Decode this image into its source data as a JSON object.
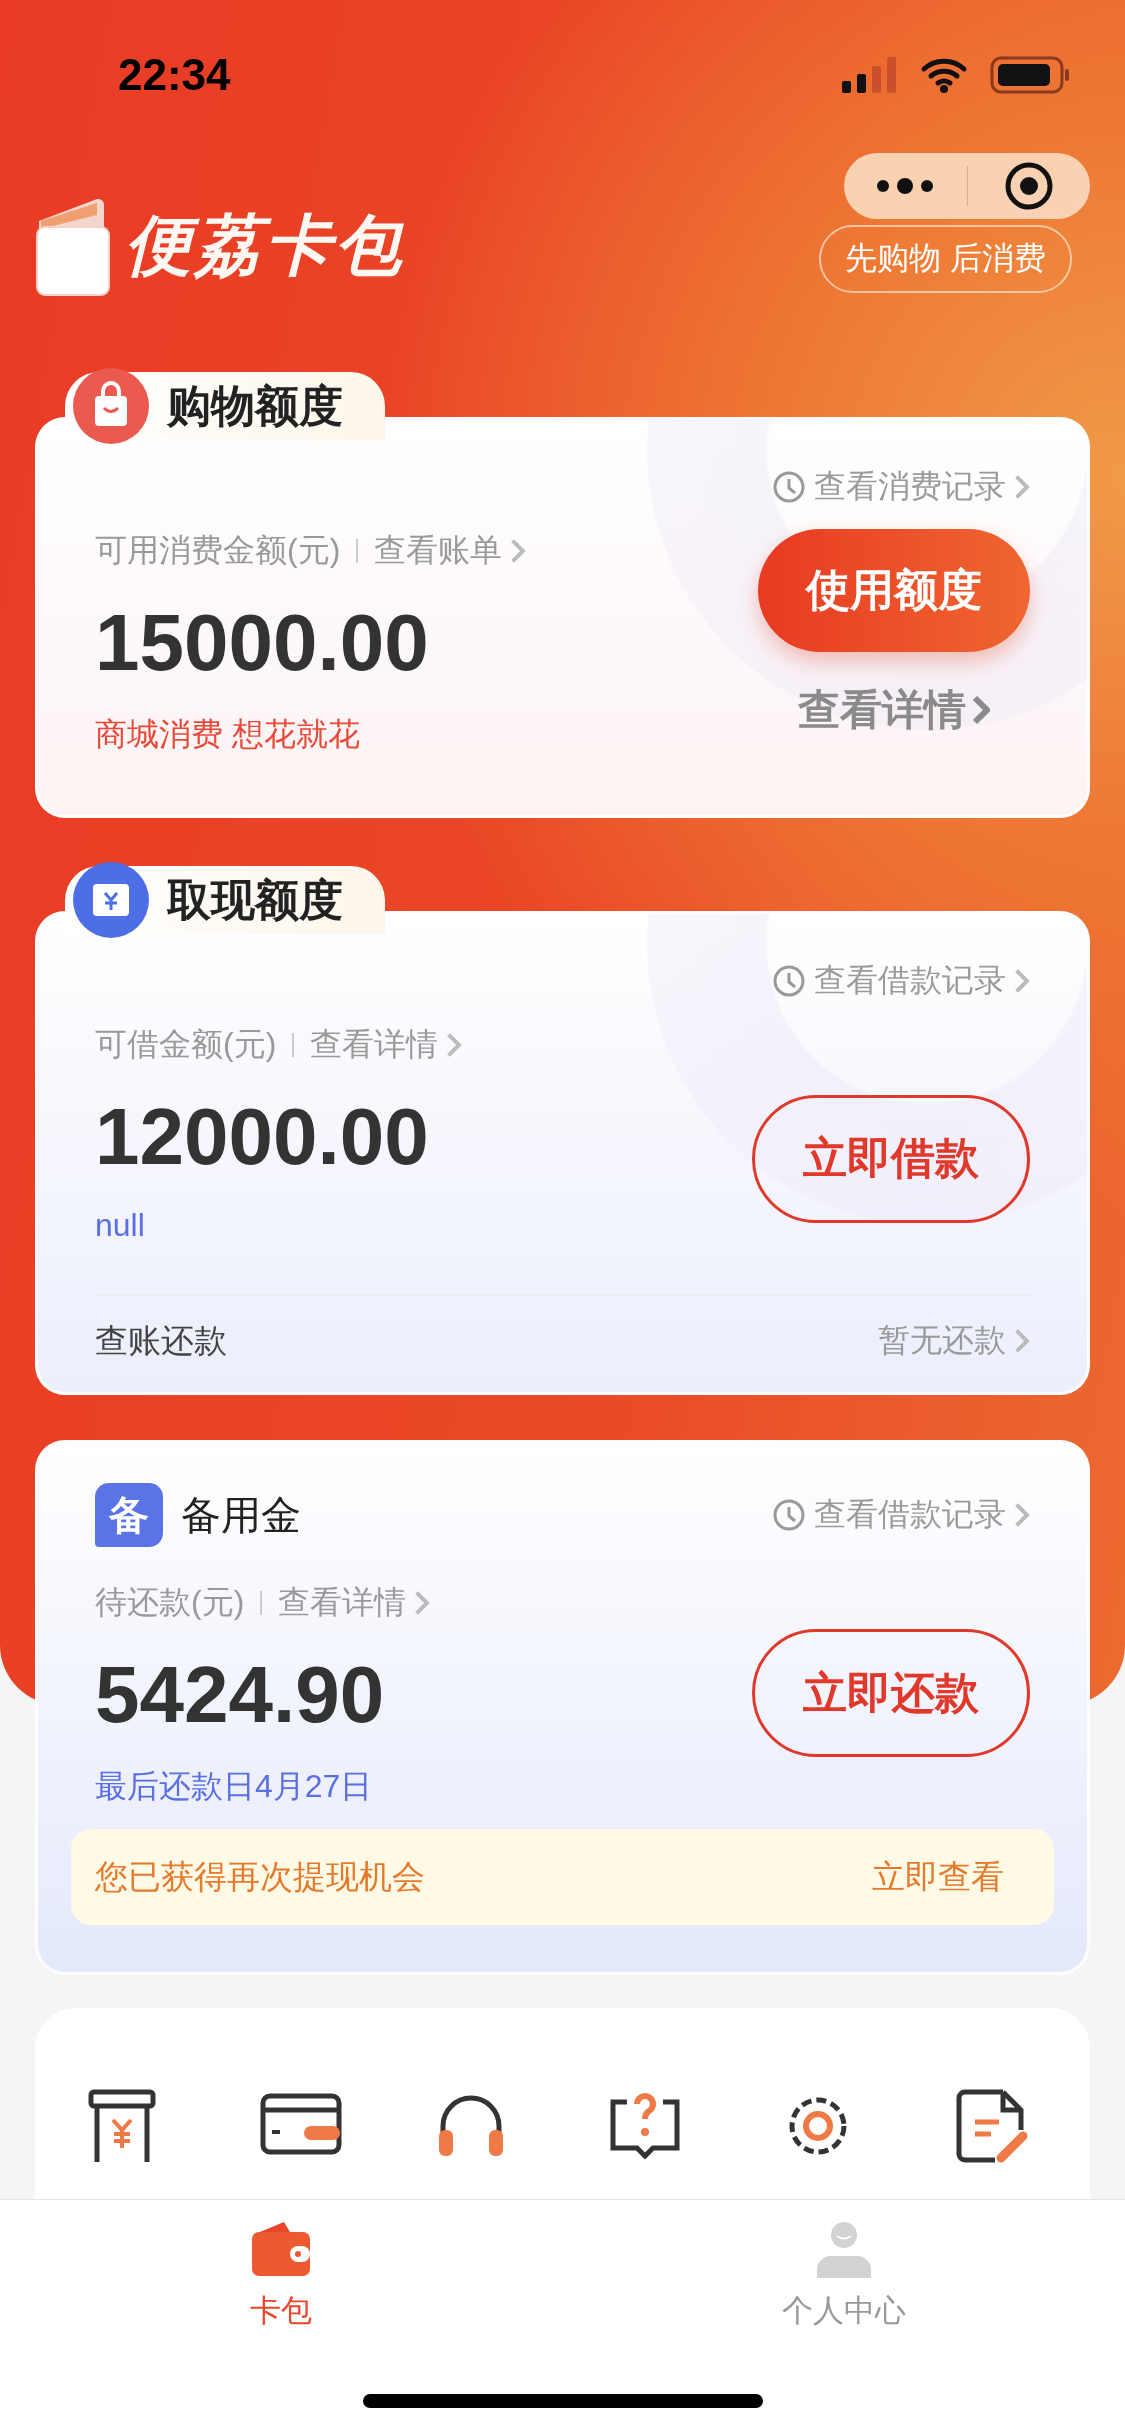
{
  "status_bar": {
    "time": "22:34"
  },
  "header": {
    "app_name": "便荔卡包",
    "slogan": "先购物 后消费"
  },
  "shopping_card": {
    "tab_label": "购物额度",
    "history_link": "查看消费记录",
    "amount_label": "可用消费金额(元)",
    "bill_link": "查看账单",
    "amount": "15000.00",
    "promo": "商城消费 想花就花",
    "button": "使用额度",
    "details_link": "查看详情"
  },
  "cash_card": {
    "tab_label": "取现额度",
    "history_link": "查看借款记录",
    "amount_label": "可借金额(元)",
    "details_link": "查看详情",
    "amount": "12000.00",
    "note": "null",
    "button": "立即借款",
    "footer_label": "查账还款",
    "footer_status": "暂无还款"
  },
  "reserve_card": {
    "badge": "备",
    "title": "备用金",
    "history_link": "查看借款记录",
    "amount_label": "待还款(元)",
    "details_link": "查看详情",
    "amount": "5424.90",
    "due_date": "最后还款日4月27日",
    "button": "立即还款",
    "notice": {
      "text": "您已获得再次提现机会",
      "action": "立即查看"
    }
  },
  "tab_bar": [
    {
      "label": "卡包",
      "selected": true
    },
    {
      "label": "个人中心",
      "selected": false
    }
  ]
}
